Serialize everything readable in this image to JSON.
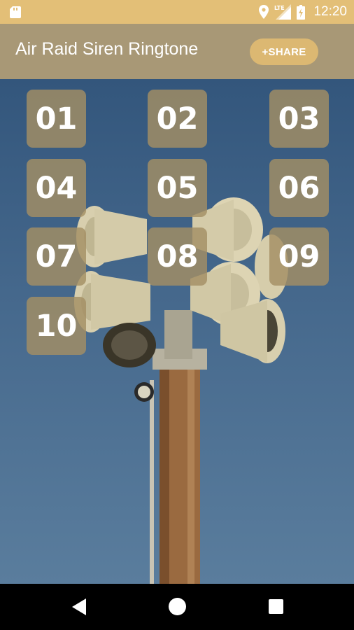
{
  "status_bar": {
    "time": "12:20",
    "network": "LTE",
    "icons": [
      "sd-card-icon",
      "location-icon",
      "signal-icon",
      "battery-icon"
    ]
  },
  "app_bar": {
    "title": "Air Raid Siren Ringtone",
    "share_label": "+SHARE"
  },
  "ringtones": [
    "01",
    "02",
    "03",
    "04",
    "05",
    "06",
    "07",
    "08",
    "09",
    "10"
  ],
  "nav": {
    "icons": [
      "back-icon",
      "home-icon",
      "recents-icon"
    ]
  },
  "colors": {
    "status_bar": "#e3bf77",
    "app_bar": "#a89876",
    "share_button": "#dcb872",
    "tone_button": "#a38f64",
    "sky": "#43668a"
  }
}
